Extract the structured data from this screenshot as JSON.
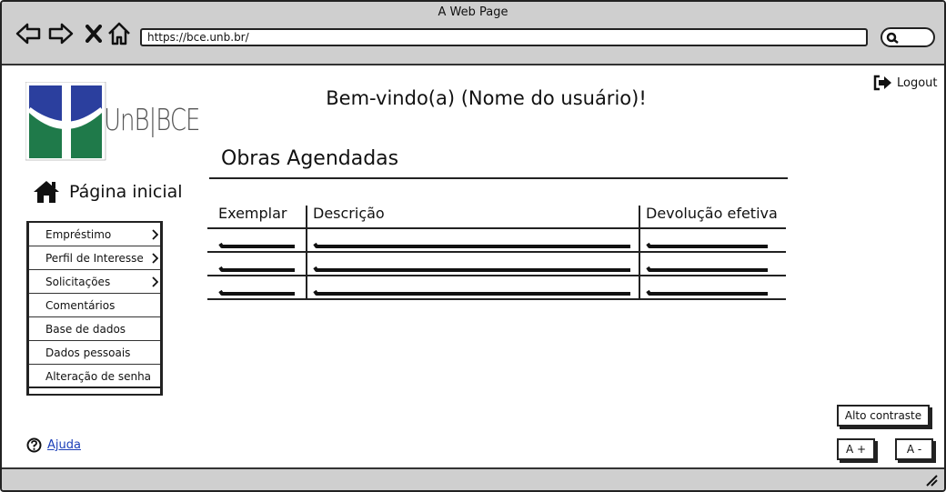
{
  "browser": {
    "window_title": "A Web Page",
    "url": "https://bce.unb.br/"
  },
  "header": {
    "logo_text": "UnB|BCE",
    "welcome": "Bem-vindo(a) (Nome do usuário)!",
    "logout_label": "Logout"
  },
  "sidebar": {
    "home_label": "Página inicial",
    "items": [
      {
        "label": "Empréstimo",
        "has_submenu": true
      },
      {
        "label": "Perfil de Interesse",
        "has_submenu": true
      },
      {
        "label": "Solicitações",
        "has_submenu": true
      },
      {
        "label": "Comentários",
        "has_submenu": false
      },
      {
        "label": "Base de dados",
        "has_submenu": false
      },
      {
        "label": "Dados pessoais",
        "has_submenu": false
      },
      {
        "label": "Alteração de senha",
        "has_submenu": false
      }
    ],
    "help_label": "Ajuda"
  },
  "main": {
    "section_title": "Obras Agendadas",
    "table": {
      "columns": [
        "Exemplar",
        "Descrição",
        "Devolução efetiva"
      ],
      "row_count": 3
    }
  },
  "accessibility": {
    "contrast_label": "Alto contraste",
    "increase_font_label": "A +",
    "decrease_font_label": "A -"
  },
  "icons": {
    "back": "arrow-left-icon",
    "forward": "arrow-right-icon",
    "stop": "close-icon",
    "home_nav": "home-icon",
    "search": "search-icon",
    "logout": "logout-icon",
    "home": "home-icon",
    "chevron": "chevron-right-icon",
    "help": "help-icon",
    "resize": "resize-grip-icon"
  },
  "colors": {
    "chrome": "#cfcfcf",
    "logo_blue": "#2b3f9e",
    "logo_green": "#1f7a4a",
    "link": "#1c3fb8"
  }
}
